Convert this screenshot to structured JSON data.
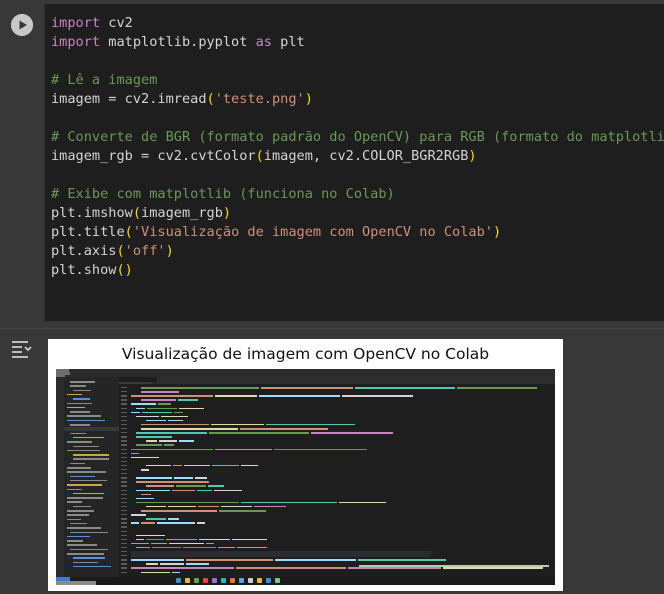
{
  "cell_input": {
    "run_button": "run-cell",
    "code_lines": [
      [
        {
          "t": "import",
          "c": "kw"
        },
        {
          "t": " cv2",
          "c": ""
        }
      ],
      [
        {
          "t": "import",
          "c": "kw"
        },
        {
          "t": " matplotlib.pyplot ",
          "c": ""
        },
        {
          "t": "as",
          "c": "kw"
        },
        {
          "t": " plt",
          "c": ""
        }
      ],
      [],
      [
        {
          "t": "# Lê a imagem",
          "c": "cm"
        }
      ],
      [
        {
          "t": "imagem = cv2.imread",
          "c": ""
        },
        {
          "t": "(",
          "c": "pa"
        },
        {
          "t": "'teste.png'",
          "c": "st"
        },
        {
          "t": ")",
          "c": "pa"
        }
      ],
      [],
      [
        {
          "t": "# Converte de BGR (formato padrão do OpenCV) para RGB (formato do matplotlib)",
          "c": "cm"
        }
      ],
      [
        {
          "t": "imagem_rgb = cv2.cvtColor",
          "c": ""
        },
        {
          "t": "(",
          "c": "pa"
        },
        {
          "t": "imagem, cv2.COLOR_BGR2RGB",
          "c": ""
        },
        {
          "t": ")",
          "c": "pa"
        }
      ],
      [],
      [
        {
          "t": "# Exibe com matplotlib (funciona no Colab)",
          "c": "cm"
        }
      ],
      [
        {
          "t": "plt.imshow",
          "c": ""
        },
        {
          "t": "(",
          "c": "pa"
        },
        {
          "t": "imagem_rgb",
          "c": ""
        },
        {
          "t": ")",
          "c": "pa"
        }
      ],
      [
        {
          "t": "plt.title",
          "c": ""
        },
        {
          "t": "(",
          "c": "pa"
        },
        {
          "t": "'Visualização de imagem com OpenCV no Colab'",
          "c": "st"
        },
        {
          "t": ")",
          "c": "pa"
        }
      ],
      [
        {
          "t": "plt.axis",
          "c": ""
        },
        {
          "t": "(",
          "c": "pa"
        },
        {
          "t": "'off'",
          "c": "st"
        },
        {
          "t": ")",
          "c": "pa"
        }
      ],
      [
        {
          "t": "plt.show",
          "c": ""
        },
        {
          "t": "()",
          "c": "pa"
        }
      ]
    ]
  },
  "cell_output": {
    "icon": "output-toggle-icon",
    "figure_title": "Visualização de imagem com OpenCV no Colab",
    "image_description_icon": "ide-screenshot"
  },
  "colors": {
    "background": "#383838",
    "editor_bg": "#1e1e1e",
    "keyword": "#c586c0",
    "comment": "#6a9955",
    "string": "#ce9178",
    "paren": "#ffd700"
  }
}
